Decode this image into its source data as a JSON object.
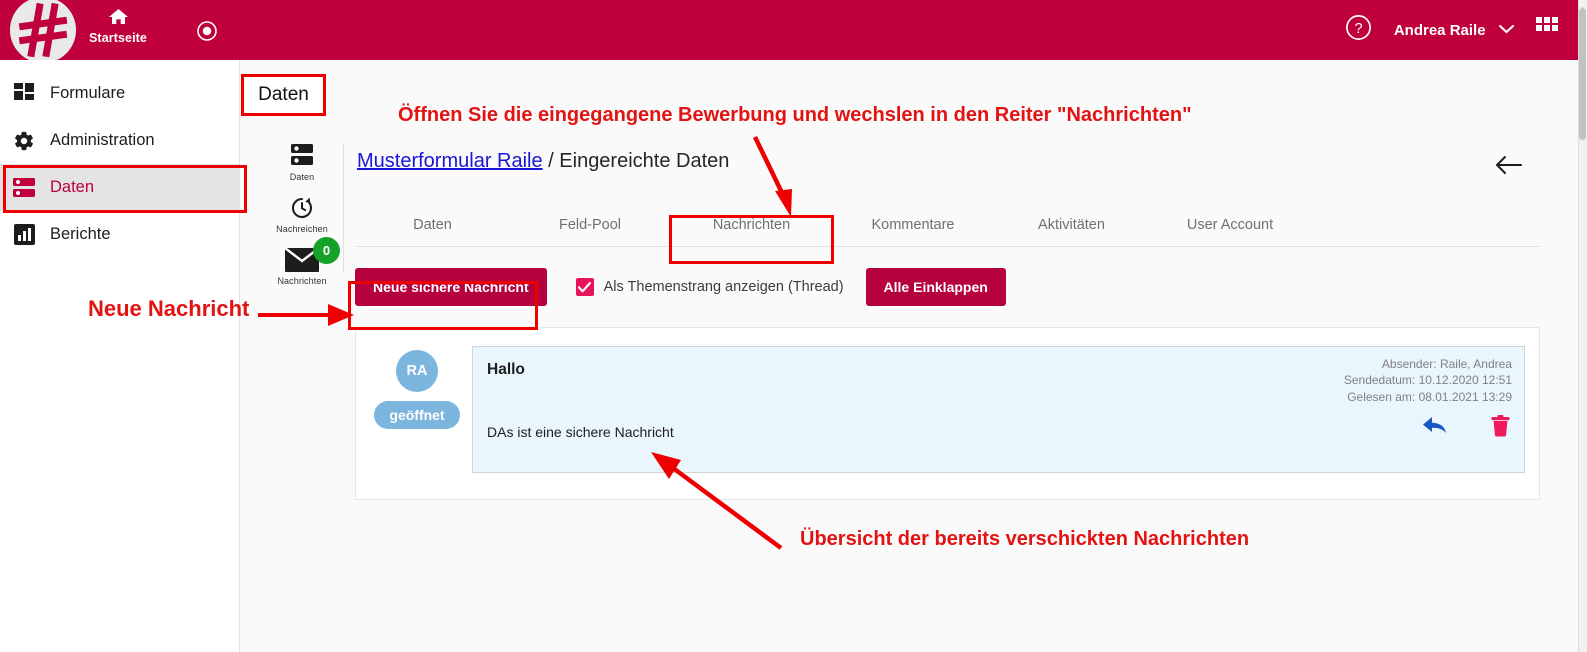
{
  "header": {
    "logo_icon": "hash-logo-icon",
    "home_label": "Startseite",
    "home_icon": "home-icon",
    "target_icon": "target-icon",
    "help_icon": "help-circle-icon",
    "user_name": "Andrea Raile",
    "chevron_icon": "chevron-down-icon",
    "apps_icon": "apps-grid-icon",
    "bg_color": "#bf003c"
  },
  "sidebar": {
    "items": [
      {
        "label": "Formulare",
        "icon": "forms-grid-icon",
        "active": false
      },
      {
        "label": "Administration",
        "icon": "gear-icon",
        "active": false
      },
      {
        "label": "Daten",
        "icon": "database-icon",
        "active": true
      },
      {
        "label": "Berichte",
        "icon": "bar-chart-icon",
        "active": false
      }
    ]
  },
  "rail": {
    "items": [
      {
        "label": "Daten",
        "icon": "database-icon",
        "badge": null
      },
      {
        "label": "Nachreichen",
        "icon": "history-clock-icon",
        "badge": null
      },
      {
        "label": "Nachrichten",
        "icon": "envelope-icon",
        "badge": "0"
      }
    ],
    "badge_color": "#16a228"
  },
  "breadcrumb": {
    "link": "Musterformular Raile",
    "separator": " / ",
    "current": "Eingereichte Daten"
  },
  "back_icon": "arrow-left-icon",
  "tabs": [
    {
      "label": "Daten",
      "active": false
    },
    {
      "label": "Feld-Pool",
      "active": false
    },
    {
      "label": "Nachrichten",
      "active": true
    },
    {
      "label": "Kommentare",
      "active": false
    },
    {
      "label": "Aktivitäten",
      "active": false
    },
    {
      "label": "User Account",
      "active": false
    }
  ],
  "toolbar": {
    "new_message_label": "Neue sichere Nachricht",
    "thread_checkbox_label": "Als Themenstrang anzeigen (Thread)",
    "thread_checkbox_checked": true,
    "collapse_all_label": "Alle Einklappen",
    "button_color": "#b5023c",
    "checkbox_color": "#e8145b"
  },
  "message": {
    "avatar_initials": "RA",
    "status_pill": "geöffnet",
    "title": "Hallo",
    "body": "DAs ist eine sichere Nachricht",
    "meta": {
      "sender": "Absender: Raile, Andrea",
      "sent": "Sendedatum: 10.12.2020 12:51",
      "read": "Gelesen am: 08.01.2021 13:29"
    },
    "reply_icon": "reply-arrow-icon",
    "delete_icon": "trash-icon",
    "bg_color": "#eaf6fd"
  },
  "annotations": {
    "color": "#e21313",
    "daten_box_label": "Daten",
    "top_note": "Öffnen Sie die eingegangene Bewerbung und wechslen in den Reiter \"Nachrichten\"",
    "left_note": "Neue Nachricht",
    "bottom_note": "Übersicht der bereits verschickten Nachrichten"
  }
}
